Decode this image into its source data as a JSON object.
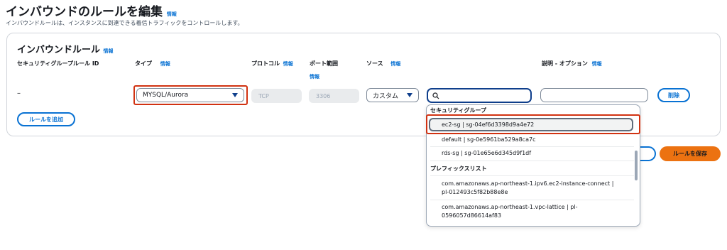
{
  "page": {
    "title": "インバウンドのルールを編集",
    "info_label": "情報",
    "subtitle": "インバウンドルールは、インスタンスに到達できる着信トラフィックをコントロールします。"
  },
  "panel": {
    "title": "インバウンドルール",
    "info_label": "情報",
    "columns": {
      "rule_id": "セキュリティグループルール ID",
      "type": "タイプ",
      "protocol": "プロトコル",
      "port_range": "ポート範囲",
      "source": "ソース",
      "description": "説明 - オプション"
    }
  },
  "rule": {
    "rule_id": "–",
    "type_value": "MYSQL/Aurora",
    "protocol_value": "TCP",
    "port_value": "3306",
    "source_value": "カスタム",
    "search_value": "",
    "description_value": "",
    "delete_label": "削除"
  },
  "add_rule_label": "ルールを追加",
  "save_label": "ルールを保存",
  "dropdown": {
    "security_group_header": "セキュリティグループ",
    "security_groups": [
      "ec2-sg | sg-04ef6d3398d9a4e72",
      "default | sg-0e5961ba529a8ca7c",
      "rds-sg | sg-01e65e6d345d9f1df"
    ],
    "prefix_list_header": "プレフィックスリスト",
    "prefix_lists": [
      {
        "line1": "com.amazonaws.ap-northeast-1.ipv6.ec2-instance-connect |",
        "line2": "pl-012493c5f82b88e8e"
      },
      {
        "line1": "com.amazonaws.ap-northeast-1.vpc-lattice | pl-",
        "line2": "0596057d86614af83"
      }
    ]
  },
  "colors": {
    "link": "#0972d3",
    "primary_button": "#ec7211",
    "highlight_border": "#d13212",
    "focus_border": "#0f3f8c"
  }
}
